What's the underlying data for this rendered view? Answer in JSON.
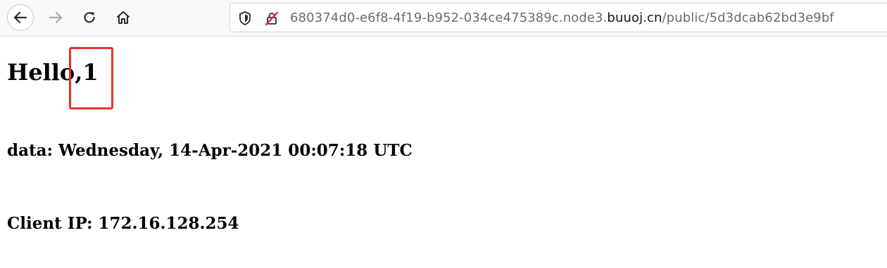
{
  "browser": {
    "nav": {
      "back_icon": "arrow-left-icon",
      "forward_icon": "arrow-right-icon",
      "reload_icon": "reload-icon",
      "home_icon": "home-icon"
    },
    "urlbar": {
      "shield_icon": "tracking-protection-shield-icon",
      "lock_icon": "insecure-lock-icon",
      "url_prefix": "680374d0-e6f8-4f19-b952-034ce475389c.node3.",
      "url_host": "buuoj.cn",
      "url_path": "/public/5d3dcab62bd3e9bf"
    }
  },
  "page": {
    "greeting": "Hello,1",
    "date_line": "data: Wednesday, 14-Apr-2021 00:07:18 UTC",
    "ip_line": "Client IP: 172.16.128.254"
  },
  "annotation": {
    "highlight_color": "#e5322d"
  }
}
